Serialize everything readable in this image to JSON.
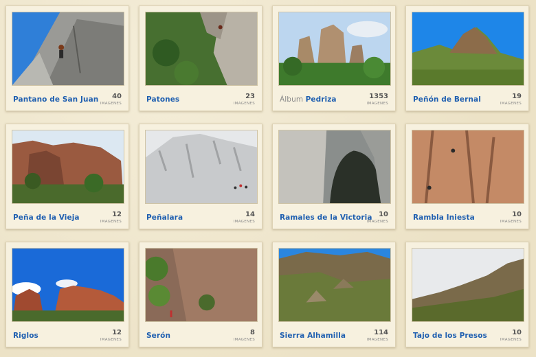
{
  "albums": [
    {
      "title": "Pantano de San Juan",
      "prefix": "",
      "count": "40",
      "unit": "IMAGENES",
      "scene": "climber-slab"
    },
    {
      "title": "Patones",
      "prefix": "",
      "count": "23",
      "unit": "IMAGENES",
      "scene": "green-cliff"
    },
    {
      "title": "Pedriza",
      "prefix": "Álbum ",
      "count": "1353",
      "unit": "IMAGENES",
      "scene": "granite-towers"
    },
    {
      "title": "Peñón de Bernal",
      "prefix": "",
      "count": "19",
      "unit": "IMAGENES",
      "scene": "bernal-peak"
    },
    {
      "title": "Peña de la Vieja",
      "prefix": "",
      "count": "12",
      "unit": "IMAGENES",
      "scene": "red-cliff"
    },
    {
      "title": "Peñalara",
      "prefix": "",
      "count": "14",
      "unit": "IMAGENES",
      "scene": "snow-slope"
    },
    {
      "title": "Ramales de la Victoria",
      "prefix": "",
      "count": "10",
      "unit": "IMAGENES",
      "scene": "cave"
    },
    {
      "title": "Rambla Iniesta",
      "prefix": "",
      "count": "10",
      "unit": "IMAGENES",
      "scene": "orange-wall"
    },
    {
      "title": "Riglos",
      "prefix": "",
      "count": "12",
      "unit": "IMAGENES",
      "scene": "riglos"
    },
    {
      "title": "Serón",
      "prefix": "",
      "count": "8",
      "unit": "IMAGENES",
      "scene": "seron"
    },
    {
      "title": "Sierra Alhamilla",
      "prefix": "",
      "count": "114",
      "unit": "IMAGENES",
      "scene": "alhamilla"
    },
    {
      "title": "Tajo de los Presos",
      "prefix": "",
      "count": "10",
      "unit": "IMAGENES",
      "scene": "tajo"
    }
  ]
}
